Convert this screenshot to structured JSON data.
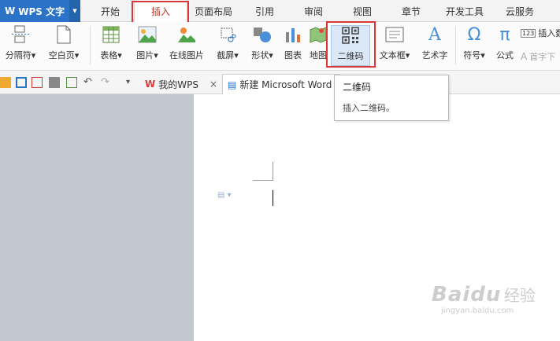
{
  "app": {
    "name": "WPS 文字",
    "logo_glyph": "W"
  },
  "tabs": [
    "开始",
    "插入",
    "页面布局",
    "引用",
    "审阅",
    "视图",
    "章节",
    "开发工具",
    "云服务"
  ],
  "active_tab": "插入",
  "ribbon": {
    "page_break": "分隔符",
    "blank_page": "空白页",
    "table": "表格",
    "picture": "图片",
    "online_picture": "在线图片",
    "screenshot": "截屏",
    "shape": "形状",
    "chart": "图表",
    "map": "地图",
    "qrcode": "二维码",
    "textbox": "文本框",
    "wordart": "艺术字",
    "symbol": "符号",
    "formula": "公式",
    "insert_number": "插入数",
    "dropcap": "首字下",
    "dropdown_glyph": "▾"
  },
  "doc_tabs": {
    "home": "我的WPS",
    "close_glyph": "×",
    "current": "新建 Microsoft Word"
  },
  "tooltip": {
    "title": "二维码",
    "desc": "插入二维码。"
  },
  "watermark": {
    "brand": "Baidu",
    "sub_cn": "经验",
    "url": "jingyan.baidu.com"
  },
  "colors": {
    "accent": "#2b73c6",
    "highlight": "#d9383a",
    "canvas": "#c3c7cf"
  }
}
